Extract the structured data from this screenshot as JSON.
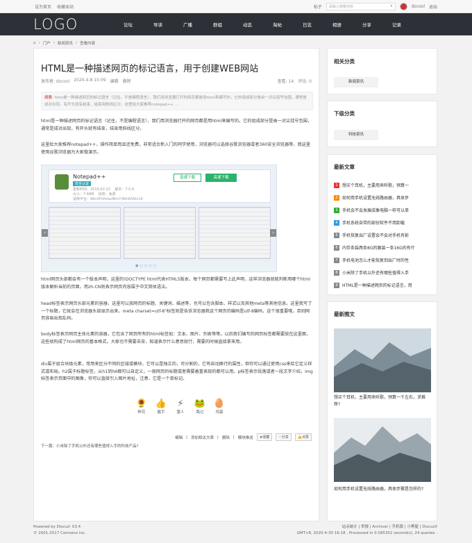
{
  "topbar": {
    "home": "设为首页",
    "fav": "收藏本站",
    "search_type": "帖子",
    "search_placeholder": "请输入搜索内容",
    "username": "dzcool",
    "logout": "退出"
  },
  "header": {
    "logo": "LOGO",
    "nav": [
      "论坛",
      "导读",
      "广播",
      "群组",
      "动态",
      "淘帖",
      "日志",
      "相册",
      "分享",
      "记录"
    ]
  },
  "breadcrumb": [
    "门户",
    "新闻资讯",
    "查看内容"
  ],
  "article": {
    "title": "HTML是一种描述网页的标记语言，用于创建WEB网站",
    "author": "发布者: dzcool",
    "date": "2020-4-8 15:09",
    "edit": "编辑",
    "delete": "删除",
    "views": "查看: 14",
    "comments": "评论: 0",
    "summary_label": "摘要",
    "summary": "html是一种描述网页的标记语言（记住，不是编程语言），我们用浏览器打开的网页都是用html来编写的。它的组成部分是由一对尖括号包围，通常是成对出现，有开头就有结束，结束用斜线区分。这里给大家推荐notepad++ ...",
    "p1": "html是一种描述网页的标记语言（记住，不是编程语言），我们用浏览器打开的网页都是用html来编写的。它的组成部分是由一对尖括号包围，通常是成对出现，有开头就有结束，结束用斜线区分。",
    "p2": "这里给大家推荐notepad++，操作简单而且还免费，非常适合新入门的同学使用，浏览器可以选择谷歌浏览器或者360安全浏览器等，我这里使用谷歌浏览器为大家做演示。",
    "p3": "html网页头部都会有一个版本声明，这里的!DOCTYPE html代表HTML5版本，每个网页都需要写上此声明，这样浏览器就能判断用哪个html版本解析当前的页面，而zh-CN则表示网页内容属于中文简体语法。",
    "p4": "head标签表示网页头部元素的容器，这里可以放网页的标题、关键词、描述等，也可以包含脚本、样式以及其他meta等其他信息。这里我写了一个标题，它就会在浏览器头部显示出来。meta charset=utf-8\"标签则是告诉浏览器我这个网页的编码是utf-8编码，这个很重要哦，否则网页容易出现乱码。",
    "p5": "body标签表示网页主体元素的容器，它包含了网页所有的html标签如：文本、图片、列表等等。以后我们编写的网页标签都需要放在这里面，这些就构成了html网页的基本格式，大家也不需要去背，知道表示什么意思就行，需要的时候直接拿来用。",
    "p6": "div属于组合块级元素，常用来区分不同的区域或模块，它可以是独立的，可分割的，它有自动换行的属性，但你可以通过使用css来给它定义样式或布局。h2属于标题标签，从h1到h6都可以自定义，一般网页的标题或者需要着重表现的都可以用，p标签表示段落或者一段文字介绍，img标签表示页面中的图像，你可以直接引入图片地址，注意，它是一个单标记。",
    "next": "下一篇：小米除了手机以外还有哪些值得入手的科技产品?"
  },
  "slider": {
    "app_name": "Notepad++",
    "tag": "安全认证",
    "info": "更新时间：2019-02-22    版本：7.5.6\n大小：7.68M    授权：免费\n适用平台：WinXP/Vista/Win7/Win8/Win10",
    "btn_normal": "普通下载",
    "btn_fast": "高速下载"
  },
  "emotions": [
    {
      "icon": "🌻",
      "label": "鲜花"
    },
    {
      "icon": "👍",
      "label": "握手"
    },
    {
      "icon": "⚡",
      "label": "雷人"
    },
    {
      "icon": "🐸",
      "label": "路过"
    },
    {
      "icon": "🥚",
      "label": "鸡蛋"
    }
  ],
  "actions": {
    "edit": "编辑",
    "add_topic": "添加相关文章",
    "delete": "删除",
    "push": "模块推送",
    "fav": "收藏",
    "share": "分享",
    "like": "点赞"
  },
  "sidebar": {
    "related_cat": "相关分类",
    "cat1": "新闻资讯",
    "sub_cat": "下级分类",
    "cat2": "科技资讯",
    "latest": "最新文章",
    "articles": [
      {
        "n": "1",
        "t": "想买个耳机，主要用来听歌，预算一",
        "c": "#e33"
      },
      {
        "n": "2",
        "t": "如何用手机设置无线路由器，具体步",
        "c": "#f80"
      },
      {
        "n": "3",
        "t": "手机会不会发展成像电脑一样可以单",
        "c": "#3a3"
      },
      {
        "n": "4",
        "t": "手机系统自带的部份软件不用卸载",
        "c": "#39d"
      },
      {
        "n": "5",
        "t": "手机恢复出厂设置会不会对手机有影",
        "c": "#888"
      },
      {
        "n": "6",
        "t": "内存条装两条8G的跟装一条16G的有什",
        "c": "#888"
      },
      {
        "n": "7",
        "t": "手机电池怎么才能恢复到出厂时的性",
        "c": "#888"
      },
      {
        "n": "8",
        "t": "小米除了手机以外还有哪些值得入手",
        "c": "#888"
      },
      {
        "n": "9",
        "t": "HTML是一种描述网页的标记语言，用",
        "c": "#888"
      }
    ],
    "latest_pic": "最新图文",
    "pic1_cap": "想买个耳机，主要用来听歌，预算一千左右，求推荐?",
    "pic2_cap": "如何用手机设置无线路由器，具体步骤是怎样的?"
  },
  "footer": {
    "powered": "Powered by Discuz! X3.4",
    "copy": "© 2001-2017 Comsenz Inc.",
    "links": "站点统计 | 举报 | Archiver | 手机版 | 小黑屋 | DiscuzX",
    "gmt": "GMT+8, 2020-4-30 16:18 , Processed in 0.095352 second(s), 24 queries ."
  }
}
